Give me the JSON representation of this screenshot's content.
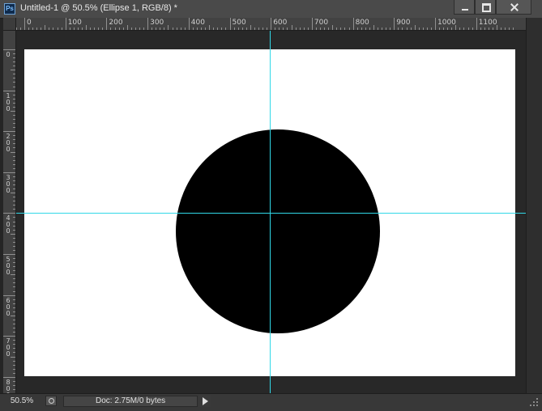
{
  "window": {
    "app_icon": "Ps",
    "title": "Untitled-1 @ 50.5% (Ellipse 1, RGB/8) *"
  },
  "rulers": {
    "horizontal_labels": [
      "0",
      "100",
      "200",
      "300",
      "400",
      "500",
      "600",
      "700",
      "800",
      "900",
      "1000",
      "1100"
    ],
    "vertical_labels": [
      "0",
      "100",
      "200",
      "300",
      "400",
      "500",
      "600",
      "700",
      "800"
    ]
  },
  "status_bar": {
    "zoom": "50.5%",
    "doc_info": "Doc: 2.75M/0 bytes"
  },
  "colors": {
    "guide": "#31d8e8",
    "workspace": "#282828",
    "canvas": "#ffffff",
    "shape": "#000000"
  },
  "icons": [
    "photoshop-app-icon",
    "minimize-icon",
    "maximize-icon",
    "close-icon",
    "info-icon",
    "arrow-right-icon",
    "resize-grip-icon"
  ]
}
